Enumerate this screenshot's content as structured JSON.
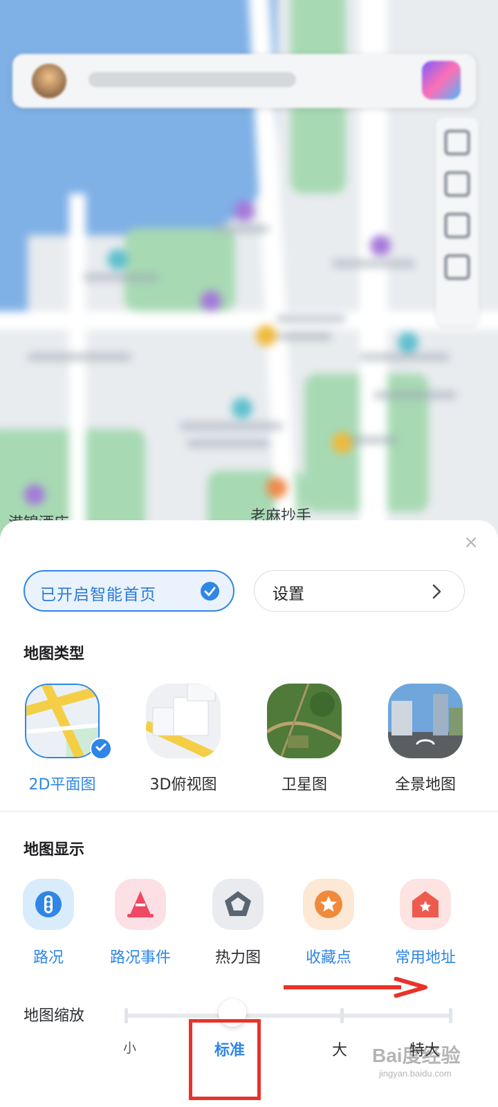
{
  "map": {
    "labels": [
      "港锦酒店",
      "老麻抄手"
    ]
  },
  "panel": {
    "smart_home_label": "已开启智能首页",
    "settings_label": "设置",
    "close_glyph": "×",
    "map_type_title": "地图类型",
    "map_types": [
      {
        "label": "2D平面图",
        "selected": true
      },
      {
        "label": "3D俯视图",
        "selected": false
      },
      {
        "label": "卫星图",
        "selected": false
      },
      {
        "label": "全景地图",
        "selected": false
      }
    ],
    "map_display_title": "地图显示",
    "display_items": [
      {
        "label": "路况",
        "icon": "traffic-light-icon",
        "color": "#2f86e6"
      },
      {
        "label": "路况事件",
        "icon": "traffic-cone-icon",
        "color": "#2f86e6"
      },
      {
        "label": "热力图",
        "icon": "pentagon-icon",
        "color": "#2b2d31"
      },
      {
        "label": "收藏点",
        "icon": "star-icon",
        "color": "#2f86e6"
      },
      {
        "label": "常用地址",
        "icon": "home-icon",
        "color": "#2f86e6"
      }
    ],
    "zoom_title": "地图缩放",
    "zoom_levels": [
      "小",
      "标准",
      "大",
      "特大"
    ],
    "zoom_selected": "标准"
  },
  "watermark": {
    "text": "Bai度经验",
    "sub": "jingyan.baidu.com"
  },
  "colors": {
    "accent": "#2f86e6",
    "annotation": "#e8332b"
  }
}
